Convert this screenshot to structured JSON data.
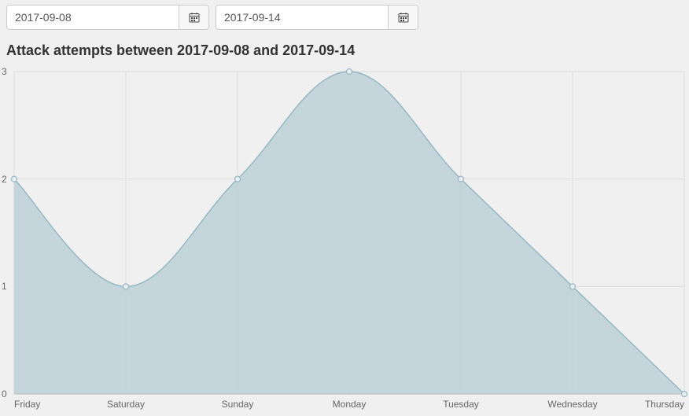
{
  "date_controls": {
    "from": {
      "value": "2017-09-08"
    },
    "to": {
      "value": "2017-09-14"
    }
  },
  "title": "Attack attempts between 2017-09-08 and 2017-09-14",
  "chart_data": {
    "type": "area",
    "categories": [
      "Friday",
      "Saturday",
      "Sunday",
      "Monday",
      "Tuesday",
      "Wednesday",
      "Thursday"
    ],
    "values": [
      2,
      1,
      2,
      3,
      2,
      1,
      0
    ],
    "ylim": [
      0,
      3
    ],
    "yticks": [
      0,
      1,
      2,
      3
    ],
    "title": "Attack attempts between 2017-09-08 and 2017-09-14",
    "xlabel": "",
    "ylabel": ""
  },
  "colors": {
    "area_fill": "#bcd1d8",
    "area_stroke": "#97b7c3",
    "grid": "#dddddd",
    "axis_text": "#666666"
  }
}
